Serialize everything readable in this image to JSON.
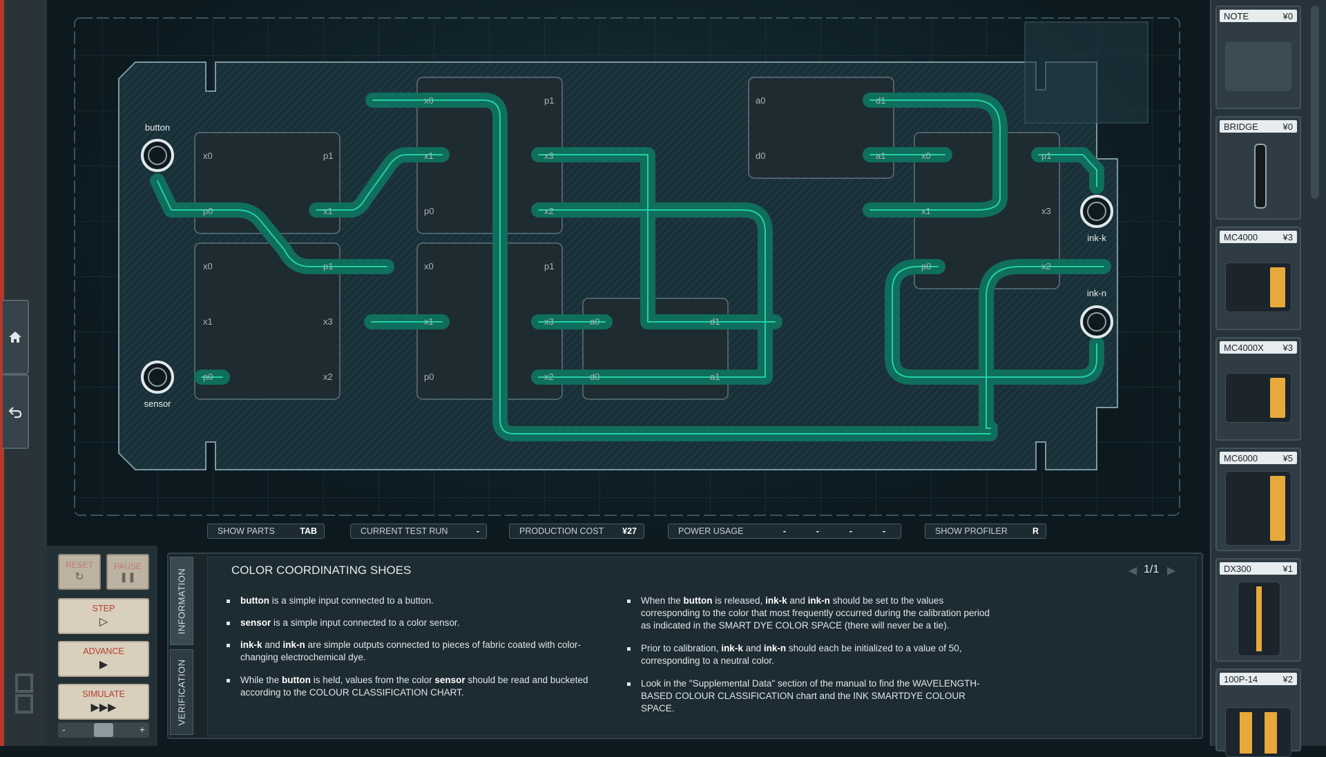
{
  "puzzle": {
    "title": "COLOR COORDINATING SHOES",
    "page": "1/1"
  },
  "tabs": {
    "information": "INFORMATION",
    "verification": "VERIFICATION"
  },
  "controls": {
    "reset": "RESET",
    "pause": "PAUSE",
    "step": "STEP",
    "advance": "ADVANCE",
    "simulate": "SIMULATE",
    "minus": "-",
    "plus": "+"
  },
  "statusbar": {
    "show_parts": "SHOW PARTS",
    "show_parts_key": "TAB",
    "current_test_run": "CURRENT TEST RUN",
    "current_test_run_value": "-",
    "production_cost": "PRODUCTION COST",
    "production_cost_value": "¥27",
    "power_usage": "POWER USAGE",
    "power_values": [
      "-",
      "-",
      "-",
      "-"
    ],
    "show_profiler": "SHOW PROFILER",
    "show_profiler_key": "R"
  },
  "palette": [
    {
      "name": "NOTE",
      "price": "¥0"
    },
    {
      "name": "BRIDGE",
      "price": "¥0"
    },
    {
      "name": "MC4000",
      "price": "¥3"
    },
    {
      "name": "MC4000X",
      "price": "¥3"
    },
    {
      "name": "MC6000",
      "price": "¥5"
    },
    {
      "name": "DX300",
      "price": "¥1"
    },
    {
      "name": "100P-14",
      "price": "¥2"
    }
  ],
  "board": {
    "inputs": {
      "button": "button",
      "sensor": "sensor"
    },
    "outputs": {
      "ink_k": "ink-k",
      "ink_n": "ink-n"
    },
    "pins": {
      "x0": "x0",
      "x1": "x1",
      "x2": "x2",
      "x3": "x3",
      "p0": "p0",
      "p1": "p1",
      "a0": "a0",
      "a1": "a1",
      "d0": "d0",
      "d1": "d1"
    }
  },
  "info": {
    "left": [
      {
        "b": "button",
        "t": " is a simple input connected to a button."
      },
      {
        "b": "sensor",
        "t": " is a simple input connected to a color sensor."
      },
      {
        "b": "ink-k",
        "m": " and ",
        "b2": "ink-n",
        "t": " are simple outputs connected to pieces of fabric coated with color-changing electrochemical dye."
      },
      {
        "p": "While the ",
        "b": "button",
        "m": " is held, values from the color ",
        "b2": "sensor",
        "t": " should be read and bucketed according to the COLOUR CLASSIFICATION CHART."
      }
    ],
    "right": [
      {
        "p": "When the ",
        "b": "button",
        "m": " is released, ",
        "b2": "ink-k",
        "m2": " and ",
        "b3": "ink-n",
        "t": " should be set to the values corresponding to the color that most frequently occurred during the calibration period as indicated in the SMART DYE COLOR SPACE (there will never be a tie)."
      },
      {
        "p": "Prior to calibration, ",
        "b": "ink-k",
        "m": " and ",
        "b2": "ink-n",
        "t": " should each be initialized to a value of 50, corresponding to a neutral color."
      },
      {
        "t": "Look in the \"Supplemental Data\" section of the manual to find the WAVELENGTH-BASED COLOUR CLASSIFICATION chart and the INK SMARTDYE COLOUR SPACE."
      }
    ]
  },
  "colors": {
    "wire": "#22d1a8",
    "board": "#1a3038",
    "accent_red": "#b53a2c"
  }
}
